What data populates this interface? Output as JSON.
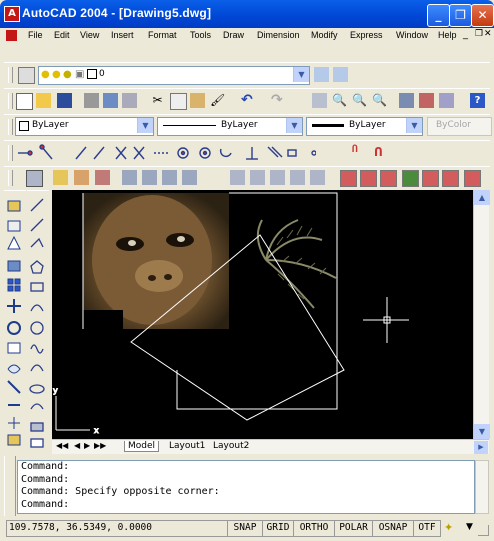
{
  "window": {
    "title": "AutoCAD 2004 - [Drawing5.dwg]",
    "minimize": "_",
    "maximize": "❐",
    "close": "✕"
  },
  "menu": [
    "File",
    "Edit",
    "View",
    "Insert",
    "Format",
    "Tools",
    "Draw",
    "Dimension",
    "Modify",
    "Express",
    "Window",
    "Help"
  ],
  "layer": {
    "current": "0"
  },
  "properties": {
    "color": "ByLayer",
    "linetype": "ByLayer",
    "lineweight": "ByLayer",
    "plotstyle": "ByColor"
  },
  "tabs": [
    "Model",
    "Layout1",
    "Layout2"
  ],
  "command_history": [
    "Command:",
    "Command:",
    "Command: Specify opposite corner:",
    "Command:"
  ],
  "status": {
    "coords": "109.7578, 36.5349, 0.0000",
    "buttons": [
      "SNAP",
      "GRID",
      "ORTHO",
      "POLAR",
      "OSNAP",
      "OTRACK"
    ],
    "otrack_visible": "OTF"
  },
  "colors": {
    "titlebar": "#0A5FE8",
    "canvas_bg": "#000000",
    "close": "#C3390F"
  }
}
